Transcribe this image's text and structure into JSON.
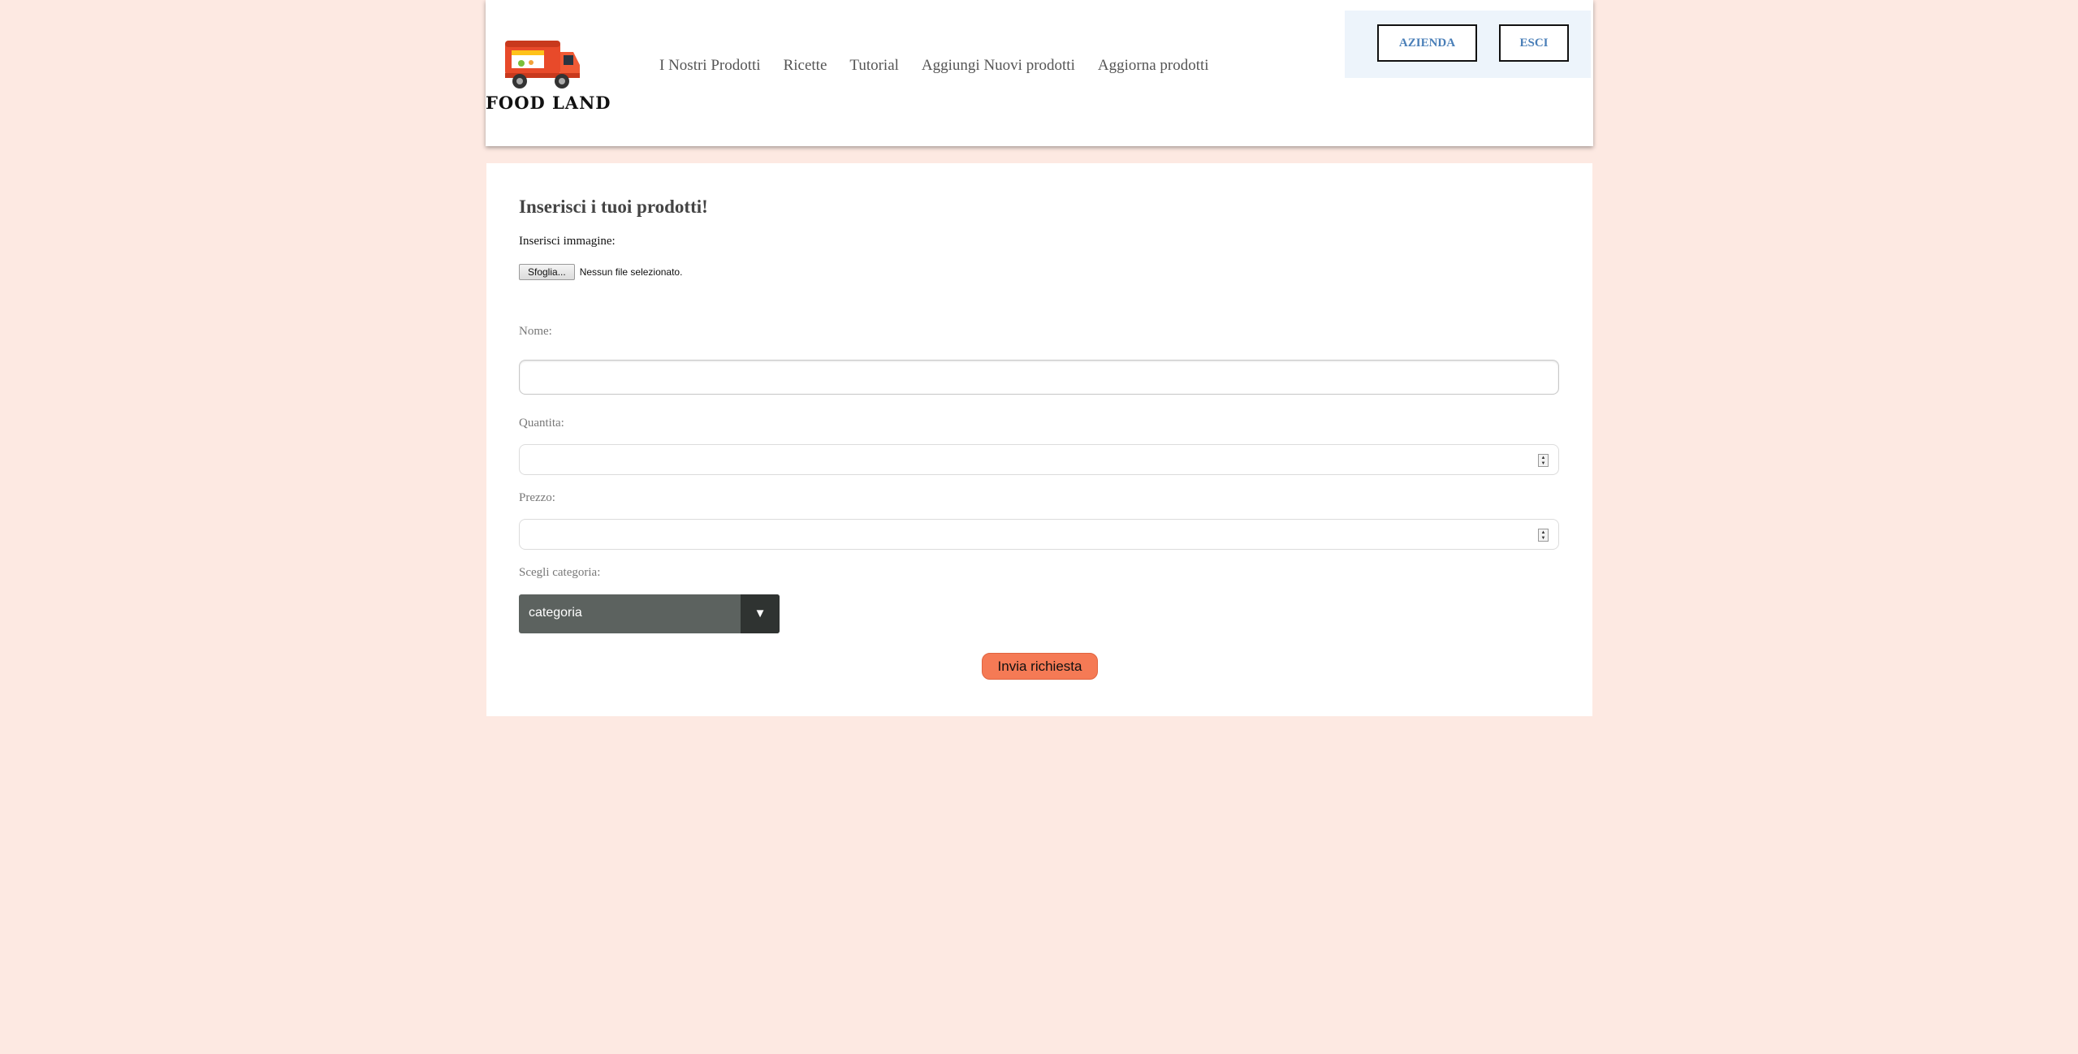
{
  "header": {
    "logo_text": "FOOD LAND",
    "nav": [
      "I Nostri Prodotti",
      "Ricette",
      "Tutorial",
      "Aggiungi Nuovi prodotti",
      "Aggiorna prodotti"
    ],
    "account_buttons": {
      "azienda": "AZIENDA",
      "esci": "ESCI"
    }
  },
  "form": {
    "title": "Inserisci i tuoi prodotti!",
    "image_label": "Inserisci immagine:",
    "file_button": "Sfoglia...",
    "file_status": "Nessun file selezionato.",
    "name_label": "Nome:",
    "name_value": "",
    "quantity_label": "Quantita:",
    "quantity_value": "",
    "price_label": "Prezzo:",
    "price_value": "",
    "category_label": "Scegli categoria:",
    "category_selected": "categoria",
    "submit_label": "Invia richiesta"
  },
  "icons": {
    "logo": "food-truck-icon",
    "select_arrow": "caret-down-icon",
    "spinner": "spinner-arrows-icon"
  },
  "colors": {
    "page_background": "#fde9e2",
    "accent_button": "#f57a55",
    "account_text": "#4a7fb8",
    "select_background": "#5c625f"
  }
}
